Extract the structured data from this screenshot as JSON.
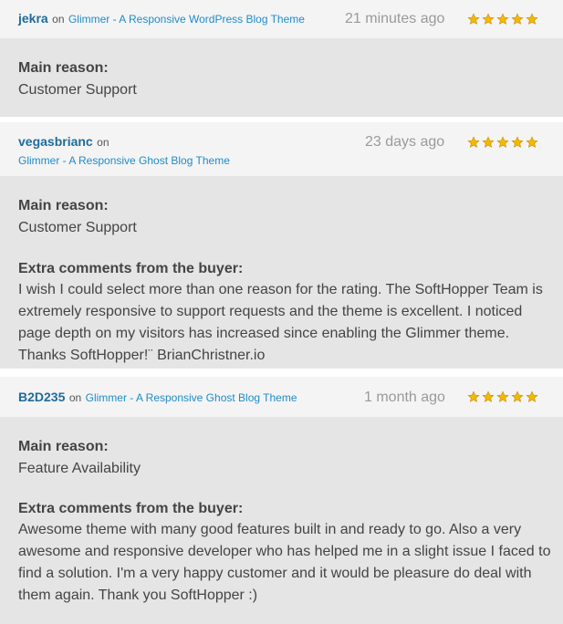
{
  "reviews": [
    {
      "user": "jekra",
      "on": "on",
      "item": "Glimmer - A Responsive WordPress Blog Theme",
      "time": "21 minutes ago",
      "rating": 5,
      "main_reason_label": "Main reason:",
      "main_reason": "Customer Support"
    },
    {
      "user": "vegasbrianc",
      "on": "on",
      "item": "Glimmer - A Responsive Ghost Blog Theme",
      "time": "23 days ago",
      "rating": 5,
      "main_reason_label": "Main reason:",
      "main_reason": "Customer Support",
      "extra_label": "Extra comments from the buyer:",
      "extra": "I wish I could select more than one reason for the rating. The SoftHopper Team is extremely responsive to support requests and the theme is excellent. I noticed page depth on my visitors has increased since enabling the Glimmer theme. Thanks SoftHopper!¨ BrianChristner.io"
    },
    {
      "user": "B2D235",
      "on": "on",
      "item": "Glimmer - A Responsive Ghost Blog Theme",
      "time": "1 month ago",
      "rating": 5,
      "main_reason_label": "Main reason:",
      "main_reason": "Feature Availability",
      "extra_label": "Extra comments from the buyer:",
      "extra": "Awesome theme with many good features built in and ready to go. Also a very awesome and responsive developer who has helped me in a slight issue I faced to find a solution. I'm a very happy customer and it would be pleasure do deal with them again. Thank you SoftHopper :)"
    }
  ],
  "colors": {
    "header_bg": "#f4f4f4",
    "body_bg": "#e5e5e5",
    "username": "#1f6c9b",
    "item_link": "#1f8cc8",
    "star": "#f5b800"
  },
  "icons": {
    "rating": "star-icon"
  }
}
